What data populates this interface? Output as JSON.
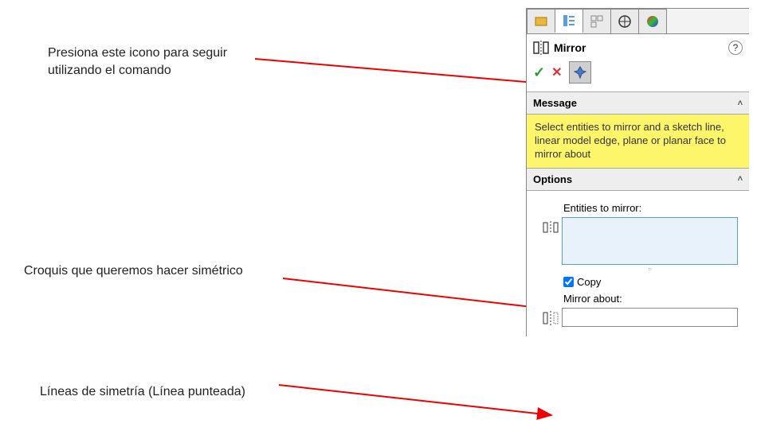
{
  "annotations": {
    "a1": "Presiona este icono para seguir utilizando el comando",
    "a2": "Croquis que queremos hacer simétrico",
    "a3": "Líneas de simetría (Línea punteada)"
  },
  "panel": {
    "title": "Mirror",
    "help_tooltip": "?",
    "message_header": "Message",
    "message_body": "Select entities to mirror and a sketch line, linear model edge, plane or planar face to mirror about",
    "options_header": "Options",
    "entities_label": "Entities to mirror:",
    "copy_label": "Copy",
    "mirror_about_label": "Mirror about:",
    "copy_checked": true
  },
  "icons": {
    "mirror": "mirror-icon",
    "ok": "✓",
    "cancel": "✕",
    "pin": "pin-icon",
    "chevron_up": "˄"
  }
}
